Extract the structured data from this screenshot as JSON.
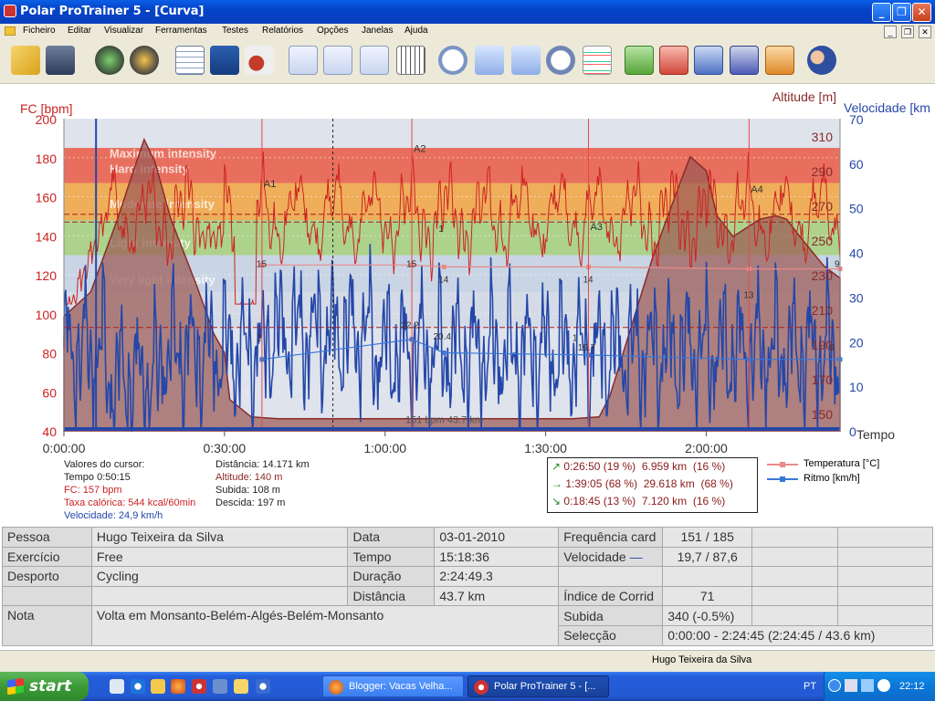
{
  "window": {
    "title": "Polar ProTrainer 5 - [Curva]"
  },
  "menu": [
    "Ficheiro",
    "Editar",
    "Visualizar",
    "Ferramentas",
    "Testes",
    "Relatórios",
    "Opções",
    "Janelas",
    "Ajuda"
  ],
  "toolbar_icons": [
    "open-folder",
    "save-disk",
    "sync-refresh",
    "settings-gear",
    "calendar",
    "book",
    "person-note",
    "curve-view",
    "bars-view",
    "percent-view",
    "table-view",
    "zoom-1-1",
    "marker-info",
    "lap-info",
    "stopwatch",
    "multi-line",
    "sport-1",
    "sport-2",
    "sport-3",
    "sport-4",
    "sport-5",
    "users"
  ],
  "chart_labels": {
    "hr_axis": "FC [bpm]",
    "alt_axis": "Altitude [m]",
    "speed_axis": "Velocidade [km",
    "time_axis": "Tempo",
    "zones": [
      "Maximum intensity",
      "Hard intensity",
      "Moderate intensity",
      "Light intensity",
      "Very light intensity"
    ],
    "markers": [
      "A1",
      "A2",
      "A3",
      "A4"
    ],
    "overlay": "151 bpm 43.7 km",
    "temp_values": [
      "15",
      "15",
      "14",
      "14",
      "13",
      "9"
    ],
    "speed_values": [
      "22.2",
      "20.4",
      "19.7",
      "9"
    ],
    "small_marks": [
      "1",
      "1",
      "1"
    ]
  },
  "chart_data": {
    "type": "line",
    "x_ticks": [
      "0:00:00",
      "0:30:00",
      "1:00:00",
      "1:30:00",
      "2:00:00"
    ],
    "hr_ticks": [
      "40",
      "60",
      "80",
      "100",
      "120",
      "140",
      "160",
      "180",
      "200"
    ],
    "alt_ticks": [
      "150",
      "170",
      "190",
      "210",
      "230",
      "250",
      "270",
      "290",
      "310"
    ],
    "speed_ticks": [
      "0",
      "10",
      "20",
      "30",
      "40",
      "50",
      "60",
      "70"
    ],
    "hr_range": [
      40,
      200
    ],
    "alt_range": [
      140,
      320
    ],
    "speed_range": [
      0,
      70
    ],
    "time_range_min": [
      0,
      145
    ],
    "zones_bpm": [
      [
        167,
        185
      ],
      [
        148,
        167
      ],
      [
        130,
        148
      ],
      [
        111,
        130
      ],
      [
        93,
        111
      ]
    ],
    "series": [
      {
        "name": "FC [bpm]",
        "color": "#cc2222"
      },
      {
        "name": "Altitude [m]",
        "color": "#8b3a3a"
      },
      {
        "name": "Velocidade [km/h]",
        "color": "#2547a8"
      },
      {
        "name": "Temperatura [°C]",
        "color": "#e98a8a"
      },
      {
        "name": "Ritmo [km/h]",
        "color": "#3a78d8"
      }
    ],
    "altitude_profile": [
      [
        0,
        206
      ],
      [
        5,
        220
      ],
      [
        10,
        262
      ],
      [
        13,
        290
      ],
      [
        15,
        308
      ],
      [
        17,
        295
      ],
      [
        20,
        262
      ],
      [
        25,
        222
      ],
      [
        28,
        196
      ],
      [
        30,
        185
      ],
      [
        31,
        158
      ],
      [
        35,
        148
      ],
      [
        40,
        147
      ],
      [
        55,
        147
      ],
      [
        70,
        147
      ],
      [
        85,
        147
      ],
      [
        95,
        147
      ],
      [
        100,
        148
      ],
      [
        102,
        160
      ],
      [
        107,
        210
      ],
      [
        110,
        240
      ],
      [
        115,
        282
      ],
      [
        117,
        298
      ],
      [
        120,
        290
      ],
      [
        122,
        264
      ],
      [
        125,
        252
      ],
      [
        130,
        262
      ],
      [
        133,
        264
      ],
      [
        135,
        262
      ],
      [
        138,
        250
      ],
      [
        142,
        235
      ],
      [
        145,
        228
      ]
    ],
    "temperature_points": [
      [
        37,
        15
      ],
      [
        65,
        15
      ],
      [
        71,
        14
      ],
      [
        98,
        14
      ],
      [
        128,
        13
      ],
      [
        145,
        13
      ]
    ],
    "pace_points": [
      [
        37,
        16
      ],
      [
        65,
        20.5
      ],
      [
        71,
        17.5
      ],
      [
        98,
        17
      ],
      [
        128,
        16
      ],
      [
        145,
        16
      ]
    ]
  },
  "legend": {
    "temp": "Temperatura [°C]",
    "pace": "Ritmo [km/h]"
  },
  "cursor": {
    "title": "Valores do cursor:",
    "tempo": "Tempo 0:50:15",
    "fc": "FC: 157 bpm",
    "taxa": "Taxa calórica: 544 kcal/60min",
    "velocidade": "Velocidade: 24,9 km/h",
    "distancia": "Distância: 14.171 km",
    "altitude": "Altitude: 140 m",
    "subida": "Subida: 108 m",
    "descida": "Descida: 197 m"
  },
  "slope_box": [
    {
      "arrow": "↗",
      "time": "0:26:50",
      "pct": "(19 %)",
      "dist": "6.959 km",
      "dpct": "(16 %)"
    },
    {
      "arrow": "→",
      "time": "1:39:05",
      "pct": "(68 %)",
      "dist": "29.618 km",
      "dpct": "(68 %)"
    },
    {
      "arrow": "↘",
      "time": "0:18:45",
      "pct": "(13 %)",
      "dist": "7.120 km",
      "dpct": "(16 %)"
    }
  ],
  "summary": {
    "pessoa_label": "Pessoa",
    "pessoa": "Hugo Teixeira da Silva",
    "exercicio_label": "Exercício",
    "exercicio": "Free",
    "desporto_label": "Desporto",
    "desporto": "Cycling",
    "nota_label": "Nota",
    "nota": "Volta em Monsanto-Belém-Algés-Belém-Monsanto",
    "data_label": "Data",
    "data": "03-01-2010",
    "tempo_label": "Tempo",
    "tempo": "15:18:36",
    "duracao_label": "Duração",
    "duracao": "2:24:49.3",
    "distancia_label": "Distância",
    "distancia": "43.7 km",
    "freq_label": "Frequência card",
    "freq": "151 / 185",
    "vel_label": "Velocidade",
    "vel": "19,7 / 87,6",
    "indice_label": "Índice de Corrid",
    "indice": "71",
    "subida_label": "Subida",
    "subida": "340 (-0.5%)",
    "selec_label": "Selecção",
    "selec": "0:00:00 - 2:24:45 (2:24:45 / 43.6 km)"
  },
  "statusbar": {
    "user": "Hugo Teixeira da Silva"
  },
  "taskbar": {
    "start": "start",
    "tasks": [
      "Blogger: Vacas Velha...",
      "Polar ProTrainer 5 - [..."
    ],
    "lang": "PT",
    "clock": "22:12"
  }
}
